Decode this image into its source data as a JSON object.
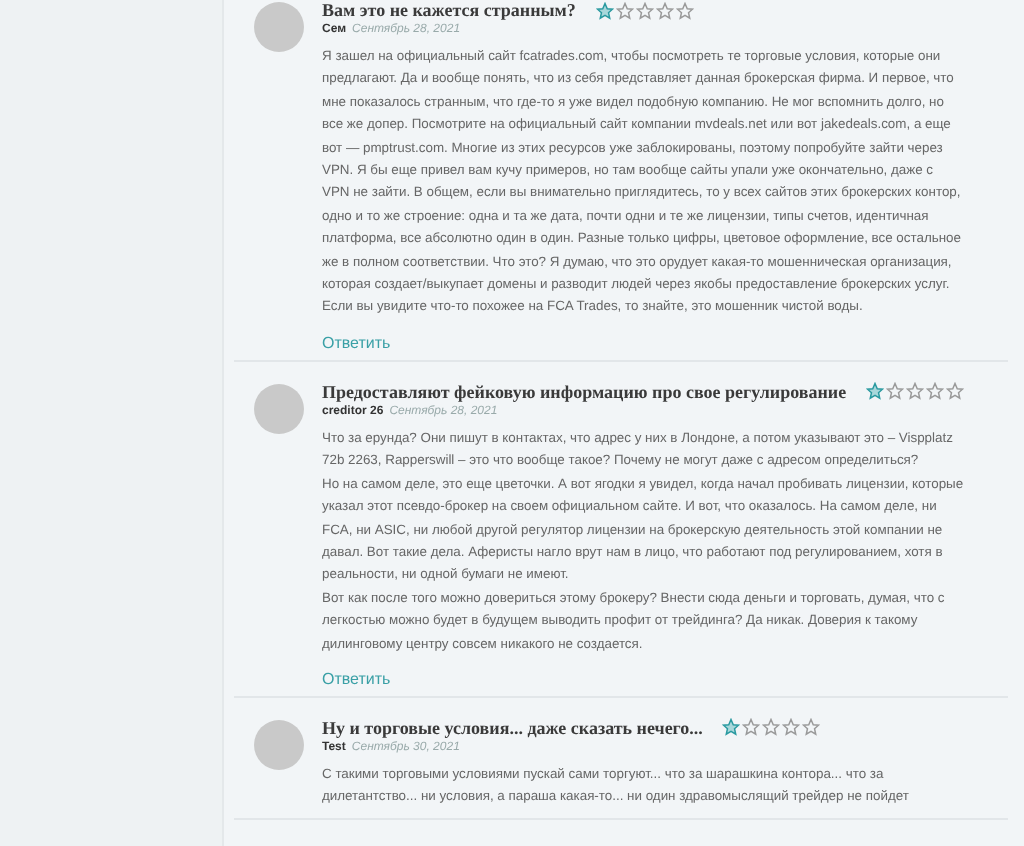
{
  "comments": [
    {
      "title": "Вам это не кажется странным?",
      "stars": 1,
      "author": "Сем",
      "date": "Сентябрь 28, 2021",
      "text": "Я зашел на официальный сайт fcatrades.com, чтобы посмотреть те торговые условия, которые они предлагают. Да и вообще понять, что из себя представляет данная брокерская фирма. И первое, что мне показалось странным, что где-то я уже видел подобную компанию. Не мог вспомнить долго, но все же допер. Посмотрите на официальный сайт компании mvdeals.net или вот jakedeals.com, а еще вот — pmptrust.com. Многие из этих ресурсов уже заблокированы, поэтому попробуйте зайти через VPN. Я бы еще привел вам кучу примеров, но там вообще сайты упали уже окончательно, даже с VPN не зайти. В общем, если вы внимательно приглядитесь, то у всех сайтов этих брокерских контор, одно и то же строение: одна и та же дата, почти одни и те же лицензии, типы счетов, идентичная платформа, все абсолютно один в один. Разные только цифры, цветовое оформление, все остальное же в полном соответствии. Что это? Я думаю, что это орудует какая-то мошенническая организация, которая создает/выкупает домены и разводит людей через якобы предоставление брокерских услуг. Если вы увидите что-то похожее на FCA Trades, то знайте, это мошенник чистой воды.",
      "reply": "Ответить"
    },
    {
      "title": "Предоставляют фейковую информацию про свое регулирование",
      "stars": 1,
      "author": "creditor 26",
      "date": "Сентябрь 28, 2021",
      "text": "Что за ерунда? Они пишут в контактах, что адрес у них в Лондоне, а потом указывают это – Vispplatz 72b 2263, Rapperswill – это что вообще такое? Почему не могут даже с адресом определиться?\nНо на самом деле, это еще цветочки. А вот ягодки я увидел, когда начал пробивать лицензии, которые указал этот псевдо-брокер на своем официальном сайте. И вот, что оказалось. На самом деле, ни FCA, ни ASIC, ни любой другой регулятор лицензии на брокерскую деятельность этой компании не давал. Вот такие дела. Аферисты нагло врут нам в лицо, что работают под регулированием, хотя в реальности, ни одной бумаги не имеют.\nВот как после того можно довериться этому брокеру? Внести сюда деньги и торговать, думая, что с легкостью можно будет в будущем выводить профит от трейдинга? Да никак. Доверия к такому дилинговому центру совсем никакого не создается.",
      "reply": "Ответить"
    },
    {
      "title": "Ну и торговые условия... даже сказать нечего...",
      "stars": 1,
      "author": "Test",
      "date": "Сентябрь 30, 2021",
      "text": "С такими торговыми условиями пускай сами торгуют... что за шарашкина контора... что за дилетантство... ни условия, а параша какая-то... ни один здравомыслящий трейдер не пойдет"
    }
  ]
}
